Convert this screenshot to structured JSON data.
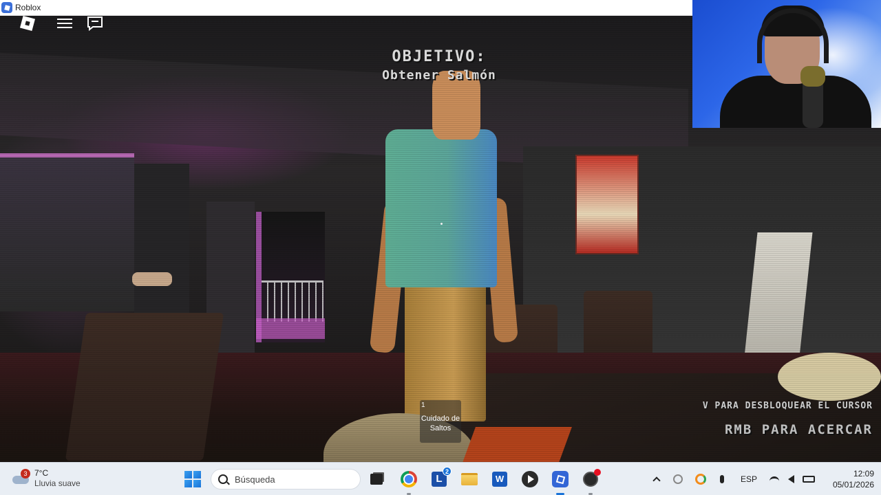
{
  "window": {
    "title": "Roblox",
    "icon": "roblox-icon"
  },
  "game": {
    "objective_heading": "OBJETIVO:",
    "objective_text": "Obtener Salmón",
    "hint_cursor": "V PARA DESBLOQUEAR EL CURSOR",
    "hint_zoom": "RMB PARA ACERCAR",
    "hotbar": [
      {
        "slot": "1",
        "label": "Cuidado de Saltos"
      }
    ],
    "top_controls": {
      "logo": "roblox-logo-icon",
      "menu": "hamburger-menu-icon",
      "chat": "chat-icon"
    }
  },
  "taskbar": {
    "weather": {
      "temp": "7°C",
      "condition": "Lluvia suave",
      "badge": "3"
    },
    "search": {
      "placeholder": "Búsqueda"
    },
    "apps": [
      {
        "name": "task-view",
        "icon": "task-view-icon"
      },
      {
        "name": "chrome",
        "icon": "chrome-icon"
      },
      {
        "name": "l-app",
        "icon": "l-app-icon",
        "letter": "L",
        "badge": "2"
      },
      {
        "name": "file-explorer",
        "icon": "folder-icon"
      },
      {
        "name": "word",
        "icon": "word-icon",
        "letter": "W"
      },
      {
        "name": "media-player",
        "icon": "play-icon"
      },
      {
        "name": "roblox",
        "icon": "roblox-icon",
        "active": true
      },
      {
        "name": "obs",
        "icon": "obs-icon"
      }
    ],
    "tray": {
      "language": "ESP",
      "time": "12:09",
      "date": "05/01/2026"
    }
  },
  "colors": {
    "taskbar": "#e9eef4",
    "accent": "#1a73d8",
    "objective_text": "#d9d9d9",
    "neon": "#c85fc6"
  }
}
